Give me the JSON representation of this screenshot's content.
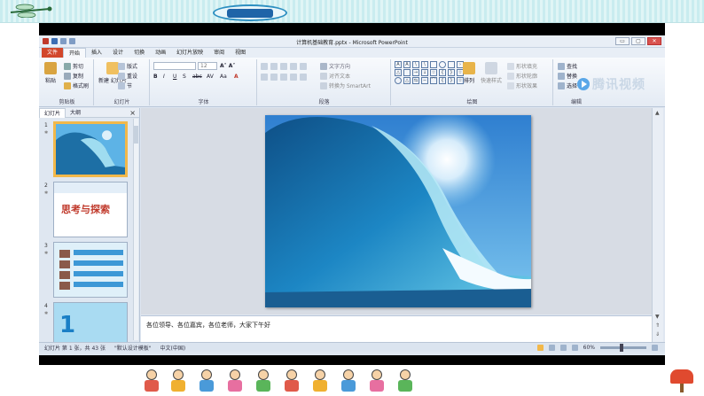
{
  "window": {
    "title": "计算机基础教育.pptx - Microsoft PowerPoint",
    "controls": [
      "▭",
      "▢",
      "✕"
    ]
  },
  "tabs": [
    "文件",
    "开始",
    "插入",
    "设计",
    "切换",
    "动画",
    "幻灯片放映",
    "审阅",
    "视图"
  ],
  "ribbon": {
    "clipboard": {
      "paste": "粘贴",
      "cut": "剪切",
      "copy": "复制",
      "format_painter": "格式刷",
      "label": "剪贴板"
    },
    "slides": {
      "new_slide": "新建\n幻灯片",
      "layout": "版式",
      "reset": "重设",
      "section": "节",
      "label": "幻灯片"
    },
    "font": {
      "size": "12",
      "bold": "B",
      "italic": "I",
      "underline": "U",
      "shadow": "S",
      "strike": "abc",
      "spacing": "AV",
      "case": "Aa",
      "color": "A",
      "label": "字体"
    },
    "paragraph": {
      "text_direction": "文字方向",
      "align_text": "对齐文本",
      "smartart": "转换为 SmartArt",
      "label": "段落"
    },
    "drawing": {
      "arrange": "排列",
      "quick_styles": "快速样式",
      "shape_fill": "形状填充",
      "shape_outline": "形状轮廓",
      "shape_effects": "形状效果",
      "label": "绘图"
    },
    "editing": {
      "find": "查找",
      "replace": "替换",
      "select": "选择",
      "label": "编辑"
    }
  },
  "watermark": "腾讯视频",
  "panel": {
    "tabs": [
      "幻灯片",
      "大纲"
    ],
    "close": "×",
    "thumbnails": [
      {
        "num": "1",
        "caption": ""
      },
      {
        "num": "2",
        "caption": "思考与探索"
      },
      {
        "num": "3",
        "caption": ""
      },
      {
        "num": "4",
        "caption": "1"
      }
    ]
  },
  "notes": "各位领导、各位嘉宾，各位老师，大家下午好",
  "status": {
    "slide_info": "幻灯片 第 1 张，共 43 张",
    "theme": "\"默认设计模板\"",
    "language": "中文(中国)",
    "zoom": "60%"
  },
  "colors": {
    "accent": "#d2472b",
    "ribbon": "#e4ebf4",
    "selection": "#f2b84a"
  }
}
